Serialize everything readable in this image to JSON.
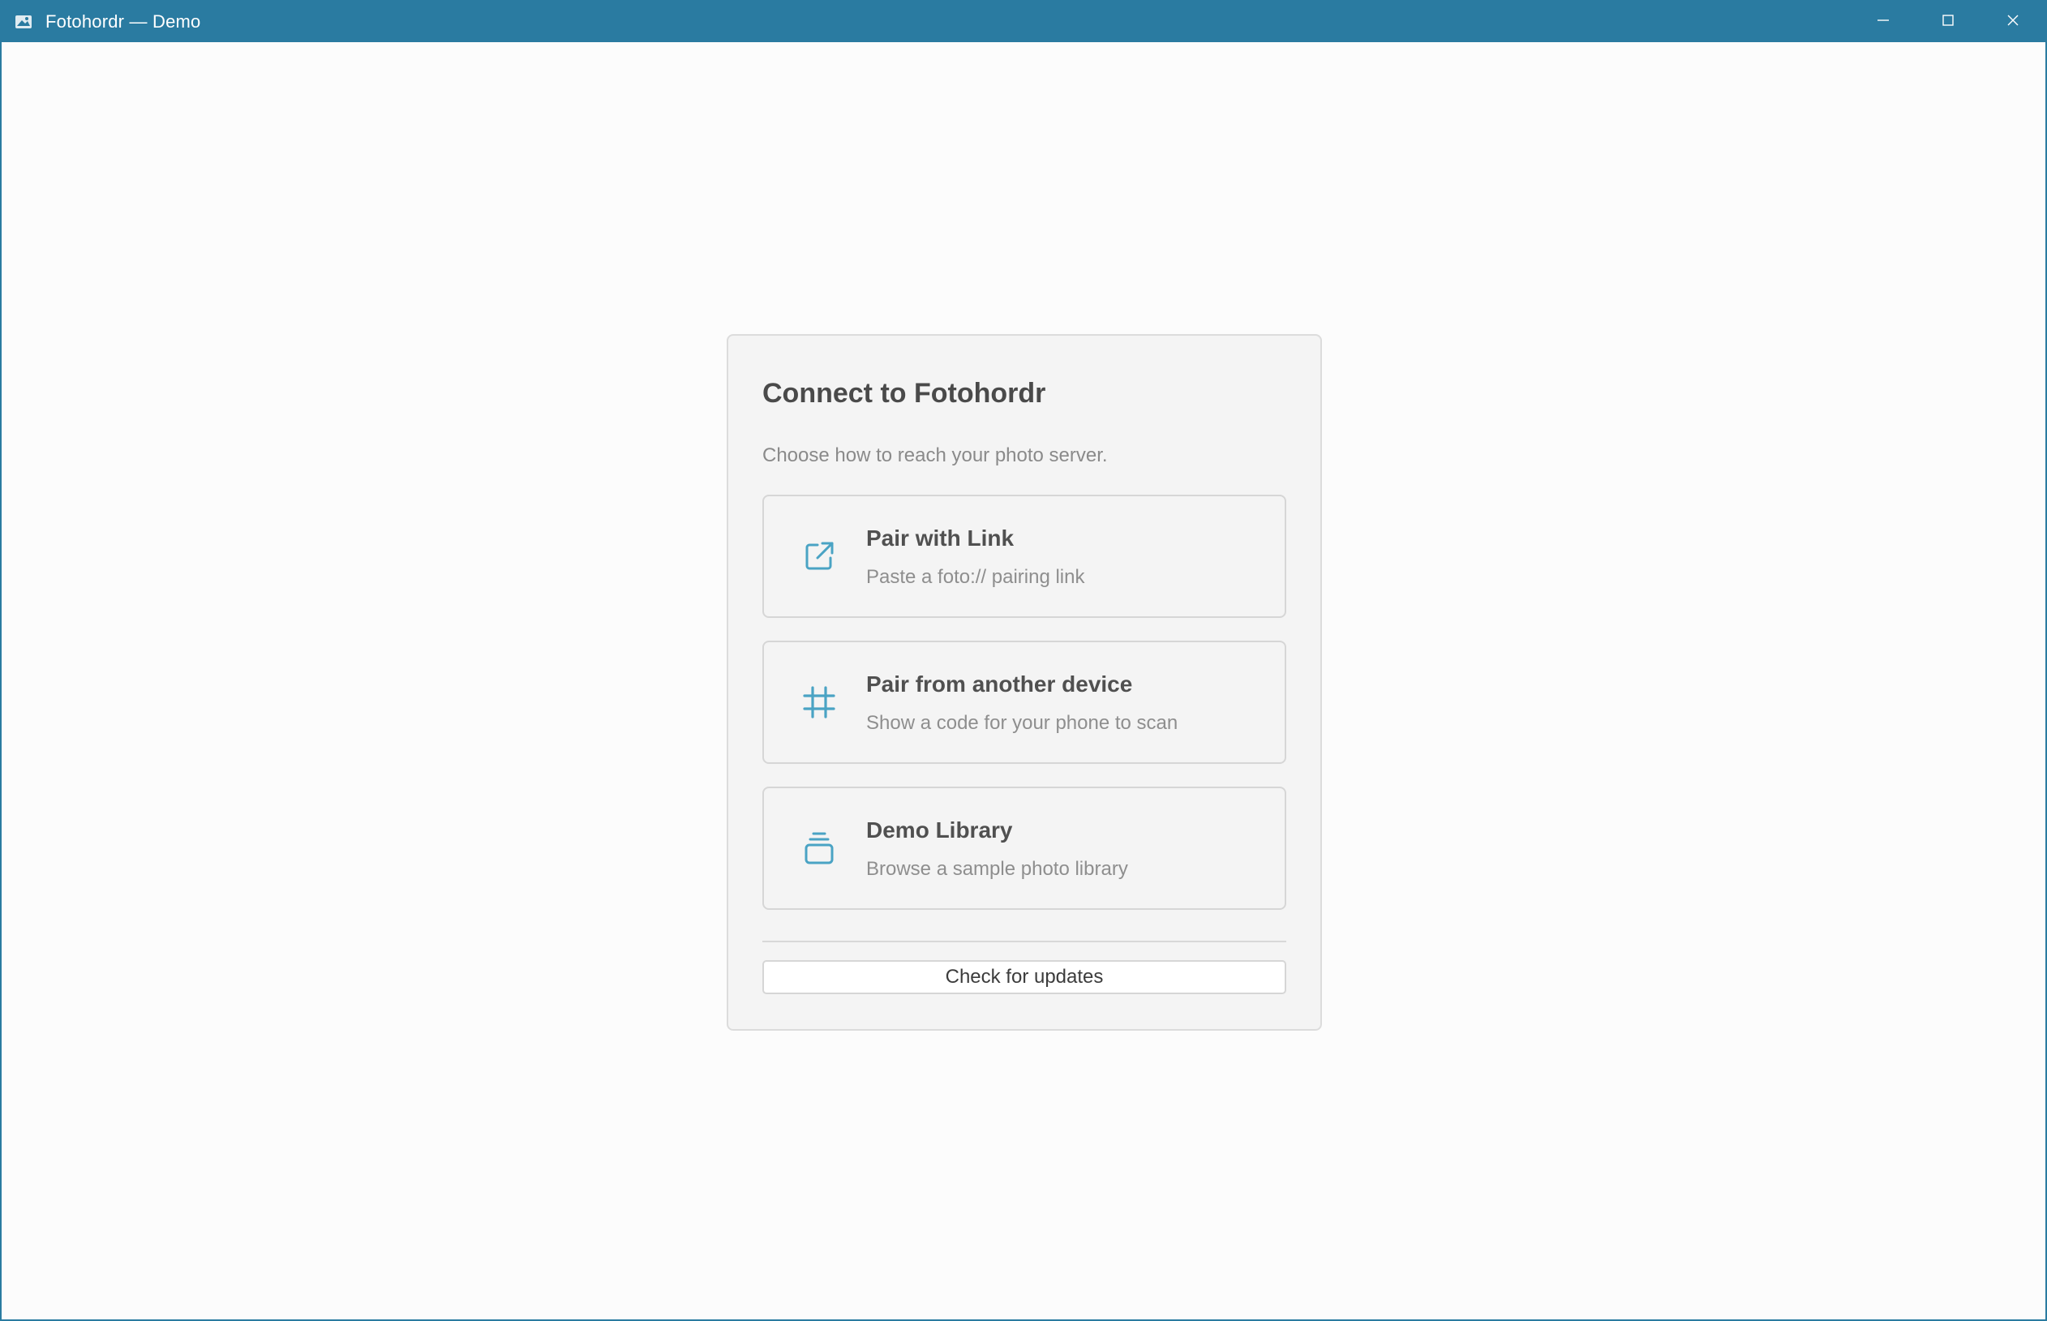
{
  "window": {
    "title": "Fotohordr — Demo",
    "accent_color": "#2a7ba1",
    "controls": [
      "minimize-icon",
      "maximize-icon",
      "close-icon"
    ]
  },
  "card": {
    "title": "Connect to Fotohordr",
    "subtitle": "Choose how to reach your photo server.",
    "options": [
      {
        "icon": "external-link-icon",
        "title": "Pair with Link",
        "description": "Paste a foto:// pairing link"
      },
      {
        "icon": "hash-icon",
        "title": "Pair from another device",
        "description": "Show a code for your phone to scan"
      },
      {
        "icon": "library-stack-icon",
        "title": "Demo Library",
        "description": "Browse a sample photo library"
      }
    ],
    "update_button_label": "Check for updates",
    "icon_color": "#4aa3c4"
  }
}
